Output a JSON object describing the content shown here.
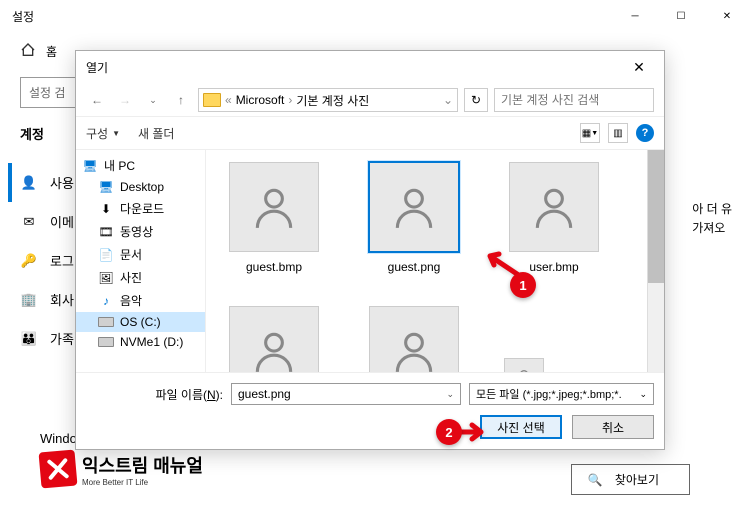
{
  "settings": {
    "title": "설정",
    "home": "홈",
    "search_placeholder": "설정 검",
    "account_heading": "계정",
    "sidebar": [
      {
        "icon": "user",
        "label": "사용"
      },
      {
        "icon": "mail",
        "label": "이메"
      },
      {
        "icon": "key",
        "label": "로그"
      },
      {
        "icon": "building",
        "label": "회사"
      },
      {
        "icon": "family",
        "label": "가족"
      }
    ],
    "backup": "Windows 백업",
    "logo_main": "익스트림 매뉴얼",
    "logo_sub": "More Better IT Life",
    "peek_right": "아 더 유\n가져오",
    "peek_bottom": "찾아보기"
  },
  "dialog": {
    "title": "열기",
    "breadcrumb": {
      "sep1": "«",
      "part1": "Microsoft",
      "sep2": "›",
      "part2": "기본 계정 사진"
    },
    "search_placeholder": "기본 계정 사진 검색",
    "toolbar": {
      "organize": "구성",
      "newfolder": "새 폴더"
    },
    "tree": [
      {
        "icon": "pc",
        "label": "내 PC",
        "indent": false
      },
      {
        "icon": "desktop",
        "label": "Desktop",
        "indent": true
      },
      {
        "icon": "download",
        "label": "다운로드",
        "indent": true
      },
      {
        "icon": "video",
        "label": "동영상",
        "indent": true
      },
      {
        "icon": "doc",
        "label": "문서",
        "indent": true
      },
      {
        "icon": "picture",
        "label": "사진",
        "indent": true
      },
      {
        "icon": "music",
        "label": "음악",
        "indent": true
      },
      {
        "icon": "drive",
        "label": "OS (C:)",
        "indent": true,
        "selected": true
      },
      {
        "icon": "drive",
        "label": "NVMe1 (D:)",
        "indent": true
      }
    ],
    "files": [
      {
        "name": "guest.bmp",
        "selected": false
      },
      {
        "name": "guest.png",
        "selected": true
      },
      {
        "name": "user.bmp",
        "selected": false
      }
    ],
    "filename_label_before": "파일 이름(",
    "filename_label_key": "N",
    "filename_label_after": "):",
    "filename_value": "guest.png",
    "filetype_value": "모든 파일 (*.jpg;*.jpeg;*.bmp;*.",
    "open_btn": "사진 선택",
    "cancel_btn": "취소"
  },
  "annotations": {
    "badge1": "1",
    "badge2": "2"
  }
}
